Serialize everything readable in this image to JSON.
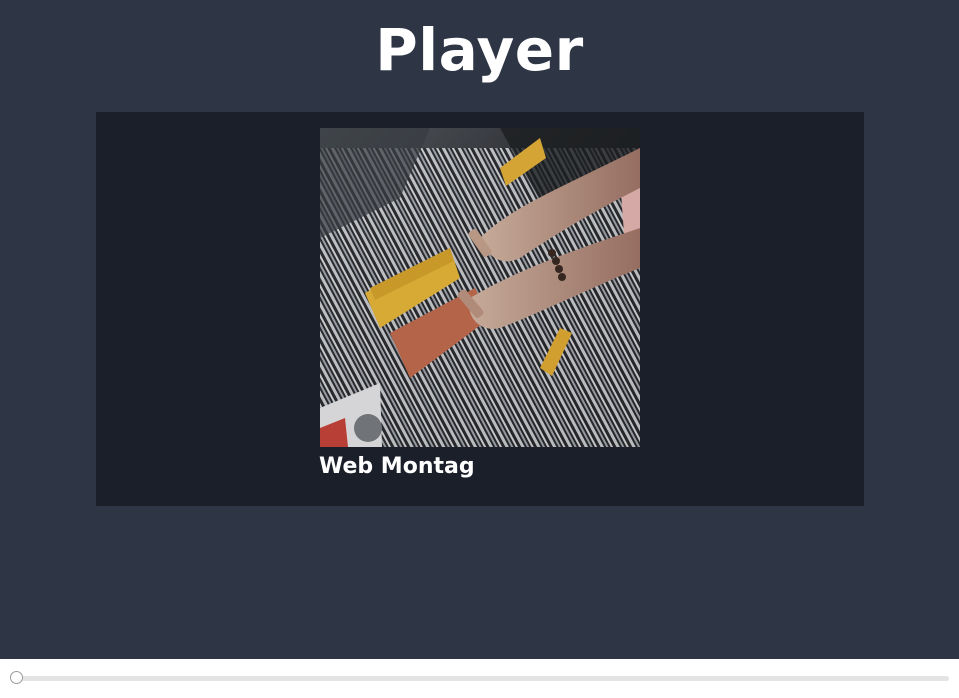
{
  "header": {
    "title": "Player"
  },
  "player": {
    "track_title": "Web Montag",
    "album_art": "vinyl-records-photo"
  },
  "seek": {
    "progress": 0.004
  },
  "colors": {
    "page_background": "#2e3545",
    "panel_background": "#1b1f2a",
    "control_bar": "#ffffff",
    "text": "#ffffff"
  }
}
